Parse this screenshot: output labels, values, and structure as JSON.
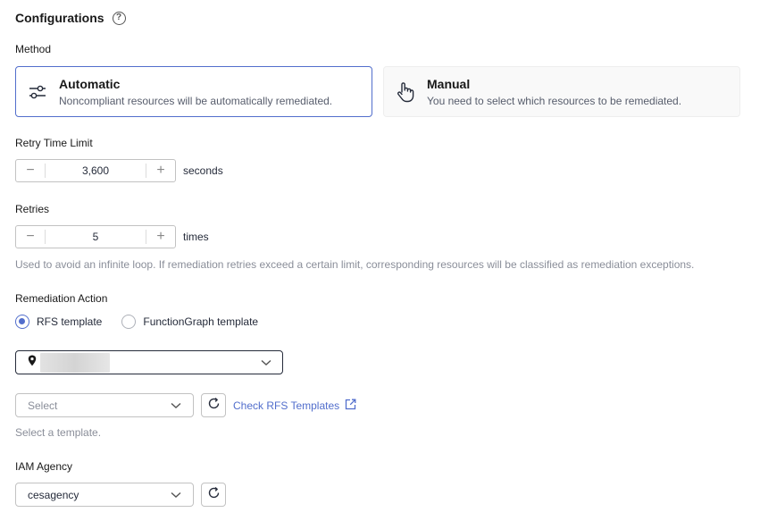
{
  "configurations": {
    "title": "Configurations",
    "help_icon": "?"
  },
  "method": {
    "label": "Method",
    "options": [
      {
        "title": "Automatic",
        "description": "Noncompliant resources will be automatically remediated.",
        "icon": "sliders-icon",
        "selected": true
      },
      {
        "title": "Manual",
        "description": "You need to select which resources to be remediated.",
        "icon": "hand-pointer-icon",
        "selected": false
      }
    ]
  },
  "retry_time_limit": {
    "label": "Retry Time Limit",
    "value": "3,600",
    "unit": "seconds",
    "decrement": "−",
    "increment": "+"
  },
  "retries": {
    "label": "Retries",
    "value": "5",
    "unit": "times",
    "decrement": "−",
    "increment": "+",
    "hint": "Used to avoid an infinite loop. If remediation retries exceed a certain limit, corresponding resources will be classified as remediation exceptions."
  },
  "remediation_action": {
    "label": "Remediation Action",
    "options": [
      {
        "label": "RFS template",
        "selected": true
      },
      {
        "label": "FunctionGraph template",
        "selected": false
      }
    ],
    "region_icon": "location-pin-icon",
    "template_select": {
      "placeholder": "Select",
      "hint": "Select a template."
    },
    "link": "Check RFS Templates"
  },
  "iam_agency": {
    "label": "IAM Agency",
    "value": "cesagency"
  },
  "colors": {
    "accent": "#526ecc",
    "text": "#252b3a",
    "hint": "#8a8e99"
  }
}
